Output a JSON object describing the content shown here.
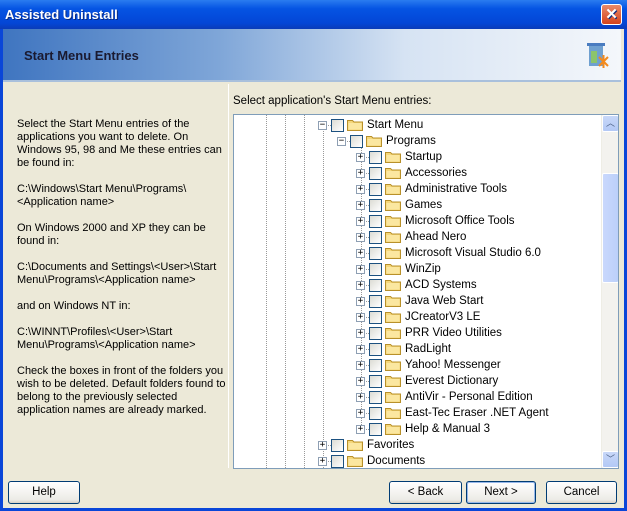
{
  "window": {
    "title": "Assisted Uninstall",
    "close_icon": "close-icon"
  },
  "header": {
    "title": "Start Menu Entries",
    "icon": "uninstall-icon"
  },
  "left_text": [
    "Select the Start Menu entries of the applications you want to delete. On Windows 95, 98 and Me these entries can be found in:",
    "C:\\Windows\\Start Menu\\Programs\\<Application name>",
    "On Windows 2000 and XP they can be found in:",
    "C:\\Documents and Settings\\<User>\\Start Menu\\Programs\\<Application name>",
    "and on Windows NT in:",
    "C:\\WINNT\\Profiles\\<User>\\Start Menu\\Programs\\<Application name>",
    "Check the boxes in front of the folders you wish to be deleted. Default folders found to belong to the previously selected application names are already marked."
  ],
  "tree": {
    "label": "Select application's Start Menu entries:",
    "items": [
      {
        "label": "Start Menu",
        "level": 0,
        "expanded": true
      },
      {
        "label": "Programs",
        "level": 1,
        "expanded": true
      },
      {
        "label": "Startup",
        "level": 2
      },
      {
        "label": "Accessories",
        "level": 2
      },
      {
        "label": "Administrative Tools",
        "level": 2
      },
      {
        "label": "Games",
        "level": 2
      },
      {
        "label": "Microsoft Office Tools",
        "level": 2
      },
      {
        "label": "Ahead Nero",
        "level": 2
      },
      {
        "label": "Microsoft Visual Studio 6.0",
        "level": 2
      },
      {
        "label": "WinZip",
        "level": 2
      },
      {
        "label": "ACD Systems",
        "level": 2
      },
      {
        "label": "Java Web Start",
        "level": 2
      },
      {
        "label": "JCreatorV3 LE",
        "level": 2
      },
      {
        "label": "PRR Video Utilities",
        "level": 2
      },
      {
        "label": "RadLight",
        "level": 2
      },
      {
        "label": "Yahoo! Messenger",
        "level": 2
      },
      {
        "label": "Everest Dictionary",
        "level": 2
      },
      {
        "label": "AntiVir - Personal Edition",
        "level": 2
      },
      {
        "label": "East-Tec Eraser .NET Agent",
        "level": 2
      },
      {
        "label": "Help & Manual 3",
        "level": 2
      },
      {
        "label": "Favorites",
        "level": 0
      },
      {
        "label": "Documents",
        "level": 0
      }
    ]
  },
  "buttons": {
    "help": "Help",
    "back": "< Back",
    "next": "Next >",
    "cancel": "Cancel"
  }
}
